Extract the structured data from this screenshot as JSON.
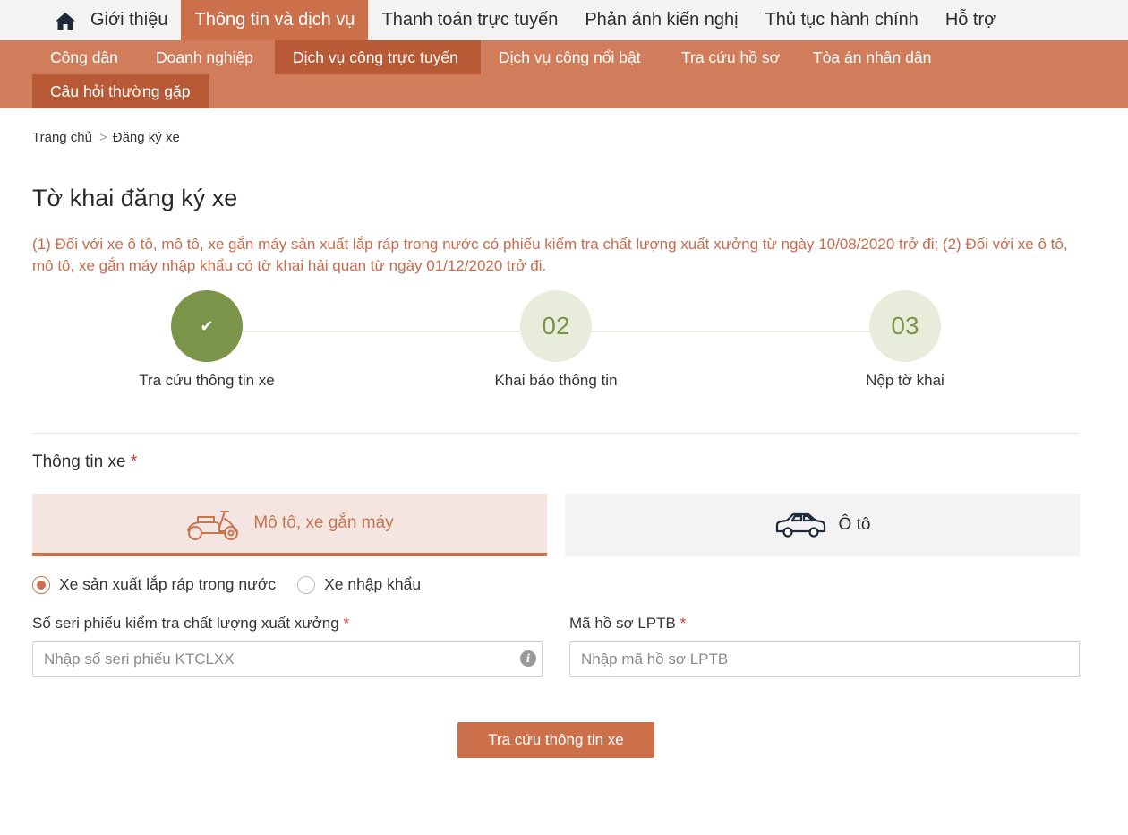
{
  "top_nav": {
    "home_icon": "home-icon",
    "items": [
      {
        "label": "Giới thiệu",
        "active": false
      },
      {
        "label": "Thông tin và dịch vụ",
        "active": true
      },
      {
        "label": "Thanh toán trực tuyến",
        "active": false
      },
      {
        "label": "Phản ánh kiến nghị",
        "active": false
      },
      {
        "label": "Thủ tục hành chính",
        "active": false
      },
      {
        "label": "Hỗ trợ",
        "active": false
      }
    ]
  },
  "sub_nav": {
    "items": [
      {
        "label": "Công dân",
        "active": false
      },
      {
        "label": "Doanh nghiệp",
        "active": false
      },
      {
        "label": "Dịch vụ công trực tuyến",
        "active": true
      },
      {
        "label": "Dịch vụ công nổi bật",
        "active": false
      },
      {
        "label": "Tra cứu hồ sơ",
        "active": false
      },
      {
        "label": "Tòa án nhân dân",
        "active": false
      },
      {
        "label": "Câu hỏi thường gặp",
        "active": false
      }
    ]
  },
  "breadcrumb": {
    "home": "Trang chủ",
    "separator": ">",
    "current": "Đăng ký xe"
  },
  "page_title": "Tờ khai đăng ký xe",
  "notice": "(1) Đối với xe ô tô, mô tô, xe gắn máy sản xuất lắp ráp trong nước có phiếu kiểm tra chất lượng xuất xưởng từ ngày 10/08/2020 trở đi; (2) Đối với xe ô tô, mô tô, xe gắn máy nhập khẩu có tờ khai hải quan từ ngày 01/12/2020 trở đi.",
  "stepper": {
    "steps": [
      {
        "number": "✔",
        "label": "Tra cứu thông tin xe",
        "status": "done"
      },
      {
        "number": "02",
        "label": "Khai báo thông tin",
        "status": "todo"
      },
      {
        "number": "03",
        "label": "Nộp tờ khai",
        "status": "todo"
      }
    ]
  },
  "vehicle_section": {
    "label": "Thông tin xe",
    "required_mark": "*",
    "tabs": [
      {
        "label": "Mô tô, xe gắn máy",
        "icon": "scooter-icon",
        "active": true
      },
      {
        "label": "Ô tô",
        "icon": "car-icon",
        "active": false
      }
    ]
  },
  "origin_radios": [
    {
      "label": "Xe sản xuất lắp ráp trong nước",
      "checked": true
    },
    {
      "label": "Xe nhập khẩu",
      "checked": false
    }
  ],
  "fields": {
    "serial": {
      "label": "Số seri phiếu kiểm tra chất lượng xuất xưởng",
      "required_mark": "*",
      "placeholder": "Nhập số seri phiếu KTCLXX",
      "value": "",
      "info_icon": "info-icon"
    },
    "lptb": {
      "label": "Mã hồ sơ LPTB",
      "required_mark": "*",
      "placeholder": "Nhập mã hồ sơ LPTB",
      "value": ""
    }
  },
  "submit_label": "Tra cứu thông tin xe",
  "colors": {
    "brand": "#cc6f4b",
    "subnav_bg": "#d17c5a",
    "subnav_active": "#b85a36",
    "step_done": "#7a9449",
    "step_todo": "#e8ecdb",
    "notice_text": "#c76b4c"
  }
}
